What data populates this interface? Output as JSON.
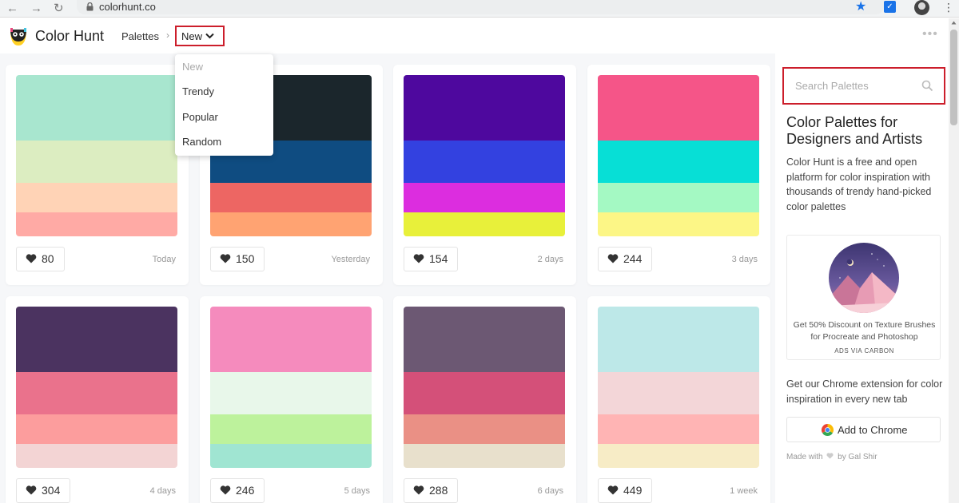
{
  "browser": {
    "url": "colorhunt.co",
    "back_icon": "arrow-left-icon",
    "forward_icon": "arrow-right-icon",
    "reload_icon": "reload-icon"
  },
  "header": {
    "brand": "Color Hunt",
    "breadcrumb_palettes": "Palettes",
    "breadcrumb_separator": "›",
    "current_filter": "New",
    "more_label": "•••"
  },
  "dropdown": {
    "items": [
      {
        "label": "New",
        "active": true
      },
      {
        "label": "Trendy",
        "active": false
      },
      {
        "label": "Popular",
        "active": false
      },
      {
        "label": "Random",
        "active": false
      }
    ]
  },
  "palettes": [
    {
      "colors": [
        "#a8e6cf",
        "#dcedc1",
        "#ffd3b6",
        "#ffaaa5"
      ],
      "likes": "80",
      "age": "Today"
    },
    {
      "colors": [
        "#1b262c",
        "#0f4c81",
        "#ed6663",
        "#ffa372"
      ],
      "likes": "150",
      "age": "Yesterday"
    },
    {
      "colors": [
        "#4e089e",
        "#3341e0",
        "#dc2ddf",
        "#e8f03a"
      ],
      "likes": "154",
      "age": "2 days"
    },
    {
      "colors": [
        "#f55588",
        "#07dfd6",
        "#a4f9c3",
        "#fcf686"
      ],
      "likes": "244",
      "age": "3 days"
    },
    {
      "colors": [
        "#4b3360",
        "#ea728c",
        "#fc9d9d",
        "#f3d4d4"
      ],
      "likes": "304",
      "age": "4 days"
    },
    {
      "colors": [
        "#f58bbd",
        "#e8f7ea",
        "#bdf29c",
        "#a0e5d2"
      ],
      "likes": "246",
      "age": "5 days"
    },
    {
      "colors": [
        "#6c5873",
        "#d45079",
        "#ea9085",
        "#e8e0cc"
      ],
      "likes": "288",
      "age": "6 days"
    },
    {
      "colors": [
        "#bde8e8",
        "#f3d6d8",
        "#ffb4b4",
        "#f7ecc6"
      ],
      "likes": "449",
      "age": "1 week"
    }
  ],
  "sidebar": {
    "search_placeholder": "Search Palettes",
    "title": "Color Palettes for Designers and Artists",
    "description": "Color Hunt is a free and open platform for color inspiration with thousands of trendy hand-picked color palettes",
    "ad_text": "Get 50% Discount on Texture Brushes for Procreate and Photoshop",
    "ad_via": "ADS VIA CARBON",
    "extension_text": "Get our Chrome extension for color inspiration in every new tab",
    "chrome_button": "Add to Chrome",
    "made_with_prefix": "Made with",
    "made_with_suffix": "by Gal Shir"
  },
  "colors": {
    "highlight_red": "#cc1e2b",
    "heart": "#333333",
    "chrome_accent": "#1a73e8"
  }
}
